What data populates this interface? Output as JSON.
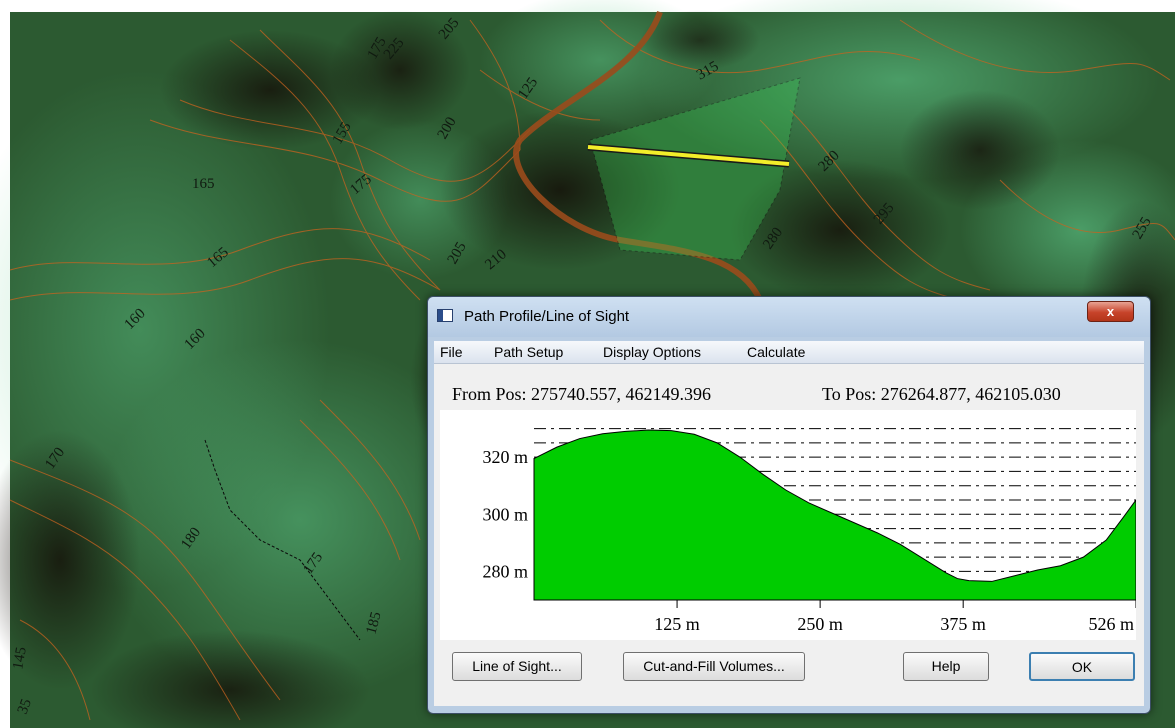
{
  "map": {
    "contour_labels": [
      "165",
      "165",
      "160",
      "160",
      "175",
      "155",
      "175",
      "200",
      "225",
      "205",
      "125",
      "315",
      "280",
      "295",
      "280",
      "205",
      "210",
      "255",
      "170",
      "180",
      "175",
      "185",
      "145",
      "35"
    ]
  },
  "dialog": {
    "title": "Path Profile/Line of Sight",
    "close_label": "x",
    "menu": [
      "File",
      "Path Setup",
      "Display Options",
      "Calculate"
    ],
    "from_pos": "From Pos: 275740.557, 462149.396",
    "to_pos": "To Pos: 276264.877, 462105.030",
    "buttons": {
      "line_of_sight": "Line of Sight...",
      "cut_fill": "Cut-and-Fill Volumes...",
      "help": "Help",
      "ok": "OK"
    }
  },
  "chart_data": {
    "type": "area",
    "x": [
      0,
      20,
      40,
      60,
      80,
      100,
      120,
      140,
      160,
      180,
      200,
      220,
      240,
      260,
      280,
      300,
      320,
      340,
      360,
      370,
      380,
      400,
      420,
      440,
      460,
      480,
      500,
      515,
      526
    ],
    "y": [
      319.5,
      323.5,
      326.5,
      328.2,
      329.0,
      329.5,
      329.3,
      328.0,
      325.0,
      320.0,
      314.0,
      308.5,
      304.0,
      300.5,
      297.0,
      293.5,
      289.5,
      284.5,
      279.5,
      277.5,
      276.8,
      276.5,
      278.5,
      280.5,
      282.0,
      285.0,
      291.0,
      299.0,
      305.0
    ],
    "xlim": [
      0,
      526
    ],
    "ylim": [
      270,
      333
    ],
    "yticks": [
      320,
      300,
      280
    ],
    "ytick_labels": [
      "320 m",
      "300 m",
      "280 m"
    ],
    "xticks": [
      125,
      250,
      375,
      526
    ],
    "xtick_labels": [
      "125 m",
      "250 m",
      "375 m",
      "526 m"
    ],
    "gridlines_y": [
      270,
      275,
      280,
      285,
      290,
      295,
      300,
      305,
      310,
      315,
      320,
      325,
      330
    ],
    "fill_color": "#00cc00",
    "grid": "dash-dot horizontal"
  }
}
